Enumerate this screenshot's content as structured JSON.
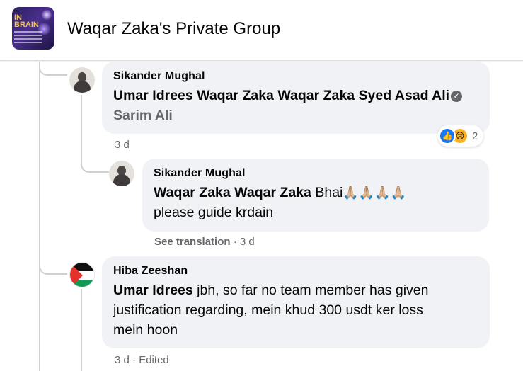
{
  "header": {
    "group_name": "Waqar Zaka's Private Group",
    "thumb_text": "IN​MY\nBRAIN"
  },
  "comments": [
    {
      "author": "Sikander Mughal",
      "mentions": [
        "Umar Idrees",
        "Waqar Zaka",
        "Waqar Zaka",
        "Syed Asad Ali"
      ],
      "mention_gray": "Sarim Ali",
      "time": "3 d",
      "reactions": {
        "icons": [
          "like-icon",
          "sad-icon"
        ],
        "count": "2"
      }
    },
    {
      "author": "Sikander Mughal",
      "mentions": [
        "Waqar Zaka",
        "Waqar Zaka"
      ],
      "body_line1": "Bhai",
      "emoji": "🙏🏼🙏🏼🙏🏼🙏🏼",
      "body_line2": "please guide krdain",
      "see_translation": "See translation",
      "time": "3 d"
    },
    {
      "author": "Hiba Zeeshan",
      "mention": "Umar Idrees",
      "body_line1": " jbh, so far no team member has given",
      "body_line2": "justification regarding, mein khud 300 usdt ker loss",
      "body_line3": "mein hoon",
      "time": "3 d",
      "edited": "Edited"
    }
  ],
  "colors": {
    "bubble_bg": "#f0f2f5",
    "meta_text": "#65676b",
    "like_blue": "#1877f2",
    "thread_line": "#ced0d4"
  }
}
